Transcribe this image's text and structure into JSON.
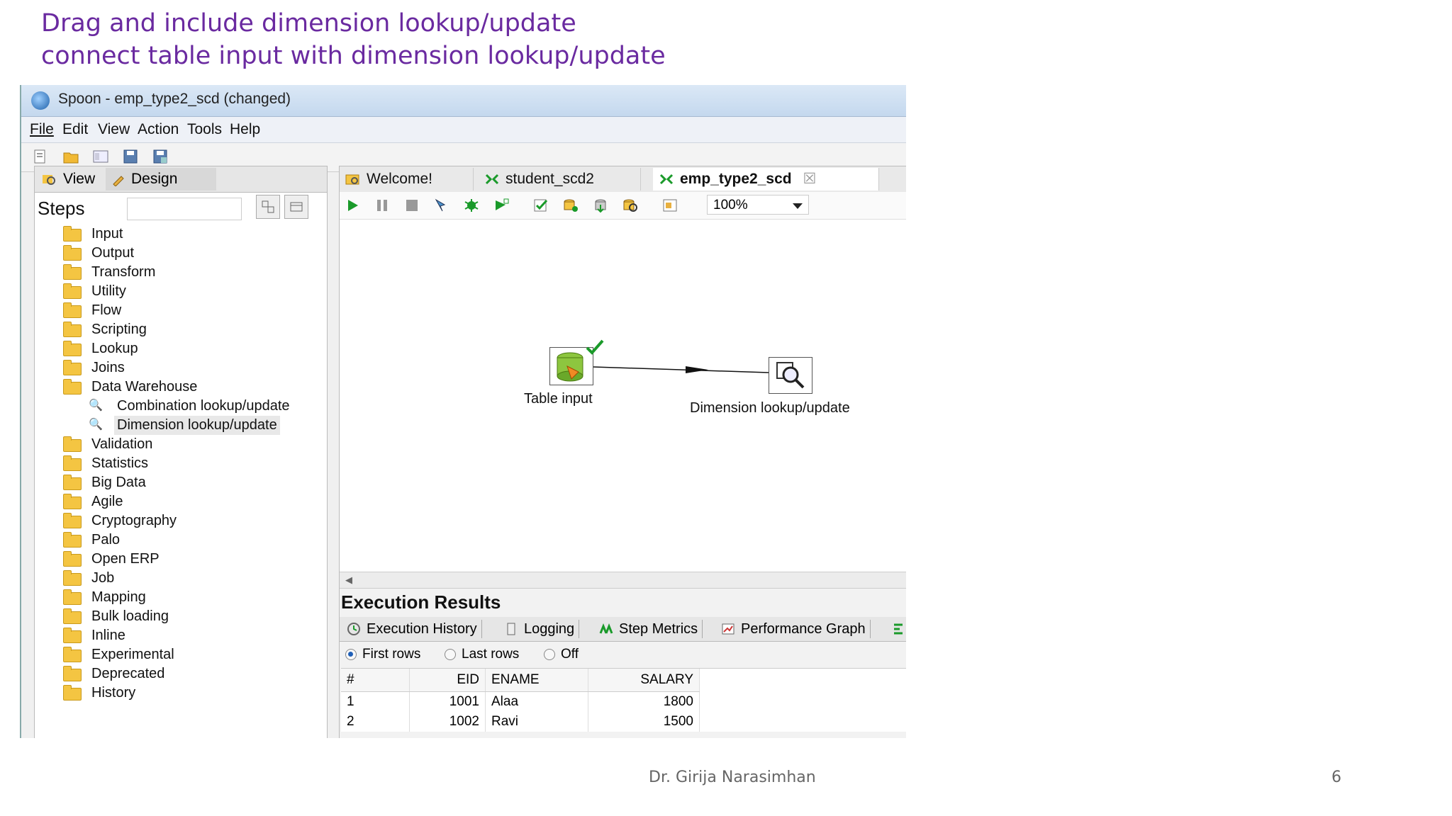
{
  "slide": {
    "title_line1": "Drag and include dimension lookup/update",
    "title_line2": "connect table input with dimension lookup/update",
    "author": "Dr. Girija Narasimhan",
    "page_number": "6"
  },
  "window": {
    "title": "Spoon - emp_type2_scd (changed)"
  },
  "menu": [
    "File",
    "Edit",
    "View",
    "Action",
    "Tools",
    "Help"
  ],
  "left_panel": {
    "tab_view": "View",
    "tab_design": "Design",
    "steps_label": "Steps",
    "tree": [
      {
        "label": "Input"
      },
      {
        "label": "Output"
      },
      {
        "label": "Transform"
      },
      {
        "label": "Utility"
      },
      {
        "label": "Flow"
      },
      {
        "label": "Scripting"
      },
      {
        "label": "Lookup"
      },
      {
        "label": "Joins"
      },
      {
        "label": "Data Warehouse"
      },
      {
        "label": "Combination lookup/update"
      },
      {
        "label": "Dimension lookup/update"
      },
      {
        "label": "Validation"
      },
      {
        "label": "Statistics"
      },
      {
        "label": "Big Data"
      },
      {
        "label": "Agile"
      },
      {
        "label": "Cryptography"
      },
      {
        "label": "Palo"
      },
      {
        "label": "Open ERP"
      },
      {
        "label": "Job"
      },
      {
        "label": "Mapping"
      },
      {
        "label": "Bulk loading"
      },
      {
        "label": "Inline"
      },
      {
        "label": "Experimental"
      },
      {
        "label": "Deprecated"
      },
      {
        "label": "History"
      }
    ]
  },
  "editor": {
    "tabs": [
      "Welcome!",
      "student_scd2",
      "emp_type2_scd"
    ],
    "zoom": "100%",
    "nodes": {
      "table_input": "Table input",
      "dimension_lookup": "Dimension lookup/update"
    }
  },
  "execution": {
    "title": "Execution Results",
    "tabs": [
      "Execution History",
      "Logging",
      "Step Metrics",
      "Performance Graph"
    ],
    "radios": [
      "First rows",
      "Last rows",
      "Off"
    ],
    "columns": [
      "#",
      "EID",
      "ENAME",
      "SALARY"
    ],
    "rows": [
      [
        "1",
        "1001",
        "Alaa",
        "1800"
      ],
      [
        "2",
        "1002",
        "Ravi",
        "1500"
      ]
    ]
  },
  "colors": {
    "title_purple": "#6a2aa0",
    "run_green": "#1a9a2a"
  }
}
